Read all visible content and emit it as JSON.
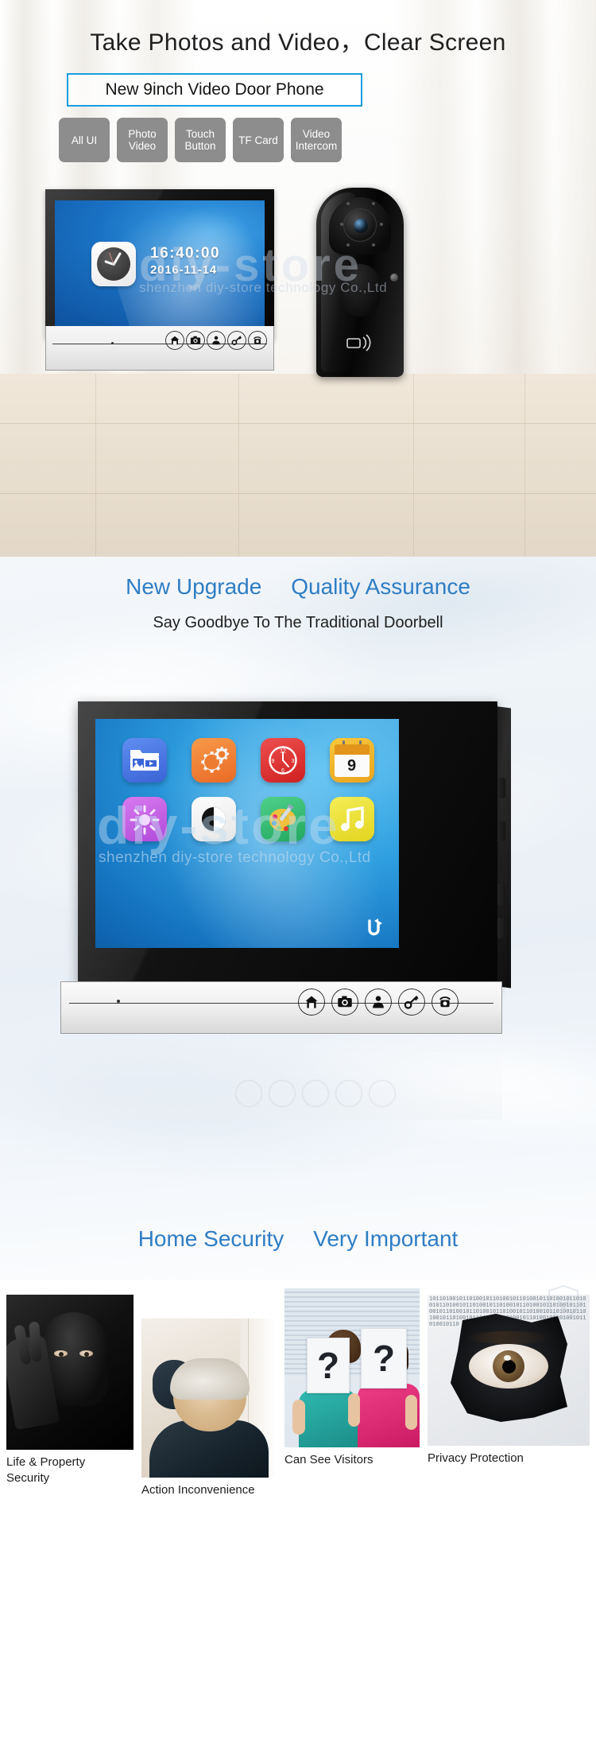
{
  "section1": {
    "headline": "Take Photos and Video，Clear Screen",
    "title_box": "New 9inch Video Door Phone",
    "chips": [
      {
        "line1": "All UI",
        "line2": ""
      },
      {
        "line1": "Photo",
        "line2": "Video"
      },
      {
        "line1": "Touch",
        "line2": "Button"
      },
      {
        "line1": "TF Card",
        "line2": ""
      },
      {
        "line1": "Video",
        "line2": "Intercom"
      }
    ],
    "monitor": {
      "time": "16:40:00",
      "date": "2016-11-14",
      "touch_buttons": [
        "home-icon",
        "camera-icon",
        "unlock-person-icon",
        "key-icon",
        "intercom-icon"
      ]
    },
    "watermark_main": "diy-store",
    "watermark_sub": "shenzhen diy-store technology Co.,Ltd"
  },
  "section2": {
    "heading_left": "New Upgrade",
    "heading_right": "Quality Assurance",
    "subheading": "Say Goodbye To The Traditional Doorbell",
    "footer_left": "Home Security",
    "footer_right": "Very Important",
    "watermark_main": "diy-store",
    "watermark_sub": "shenzhen diy-store technology Co.,Ltd",
    "apps": [
      {
        "name": "media-folder-icon",
        "label": ""
      },
      {
        "name": "settings-gear-icon",
        "label": ""
      },
      {
        "name": "clock-icon",
        "label": ""
      },
      {
        "name": "calendar-icon",
        "label": "9"
      },
      {
        "name": "brightness-icon",
        "label": ""
      },
      {
        "name": "contrast-icon",
        "label": ""
      },
      {
        "name": "palette-icon",
        "label": ""
      },
      {
        "name": "music-icon",
        "label": ""
      }
    ],
    "back_label": "back-arrow-icon",
    "touch_buttons": [
      "home-icon",
      "camera-icon",
      "unlock-person-icon",
      "key-icon",
      "intercom-icon"
    ]
  },
  "section3": {
    "cards": [
      {
        "caption": "Life & Property\nSecurity",
        "name": "burglar-photo"
      },
      {
        "caption": "Action Inconvenience",
        "name": "elderly-photo"
      },
      {
        "caption": "Can See Visitors",
        "name": "visitors-photo"
      },
      {
        "caption": "Privacy Protection",
        "name": "privacy-photo"
      }
    ]
  },
  "colors": {
    "accent_blue": "#1a9de0",
    "heading_blue": "#2f7dc4",
    "chip_gray": "#8d8d8d"
  }
}
